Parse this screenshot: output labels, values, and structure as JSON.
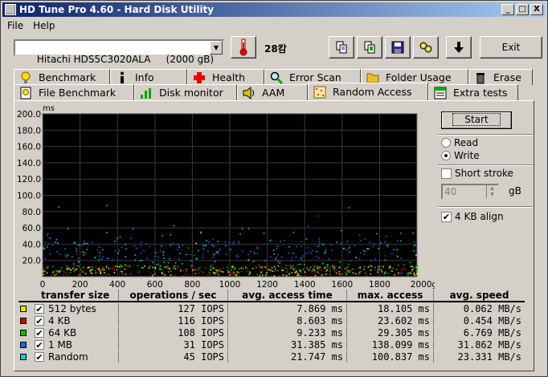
{
  "window": {
    "title": "HD Tune Pro 4.60 - Hard Disk Utility",
    "controls": [
      "_",
      "□",
      "X"
    ]
  },
  "menu": [
    "File",
    "Help"
  ],
  "toolbar": {
    "drive": "Hitachi HDS5C3020ALA     (2000 gB)",
    "temperature": "28캄",
    "exit_label": "Exit",
    "icons": [
      "thermometer-icon",
      "copy-icon",
      "copy-all-icon",
      "save-icon",
      "options-icon",
      "download-icon"
    ]
  },
  "tabs_top": [
    {
      "label": "Benchmark",
      "icon": "bulb-icon"
    },
    {
      "label": "Info",
      "icon": "info-icon"
    },
    {
      "label": "Health",
      "icon": "health-icon"
    },
    {
      "label": "Error Scan",
      "icon": "magnifier-icon"
    },
    {
      "label": "Folder Usage",
      "icon": "folder-icon"
    },
    {
      "label": "Erase",
      "icon": "trash-icon"
    }
  ],
  "tabs_bottom": [
    {
      "label": "File Benchmark",
      "icon": "bulb-file-icon"
    },
    {
      "label": "Disk monitor",
      "icon": "disk-monitor-icon"
    },
    {
      "label": "AAM",
      "icon": "speaker-icon"
    },
    {
      "label": "Random Access",
      "icon": "random-access-icon",
      "active": true
    },
    {
      "label": "Extra tests",
      "icon": "extra-tests-icon"
    }
  ],
  "side": {
    "start_label": "Start",
    "read_label": "Read",
    "write_label": "Write",
    "mode": "write",
    "short_stroke_label": "Short stroke",
    "short_stroke_checked": false,
    "short_stroke_value": "40",
    "unit": "gB",
    "align_label": "4 KB align",
    "align_checked": true
  },
  "chart_data": {
    "type": "scatter",
    "ylabel": "ms",
    "xlabel": "",
    "x_unit": "gB",
    "xlim": [
      0,
      2000
    ],
    "ylim": [
      0,
      200
    ],
    "xticks": [
      "0",
      "200",
      "400",
      "600",
      "800",
      "1000",
      "1200",
      "1400",
      "1600",
      "1800",
      "2000gB"
    ],
    "yticks": [
      "200.0",
      "180.0",
      "160.0",
      "140.0",
      "120.0",
      "100.0",
      "80.0",
      "60.0",
      "40.0",
      "20.0"
    ],
    "grid": true,
    "background": "#000000",
    "series": [
      {
        "name": "512 bytes",
        "color": "#e8e800",
        "y_typical": [
          2,
          14
        ]
      },
      {
        "name": "4 KB",
        "color": "#d00000",
        "y_typical": [
          2,
          14
        ]
      },
      {
        "name": "64 KB",
        "color": "#00c000",
        "y_typical": [
          3,
          16
        ]
      },
      {
        "name": "1 MB",
        "color": "#2060ff",
        "y_typical": [
          20,
          48
        ]
      },
      {
        "name": "Random",
        "color": "#00d0d0",
        "y_typical": [
          5,
          60
        ]
      }
    ]
  },
  "results": {
    "headers": [
      "transfer size",
      "operations / sec",
      "avg. access time",
      "max. access",
      "avg. speed"
    ],
    "rows": [
      {
        "color": "#e8e800",
        "size": "512 bytes",
        "ops": "127 IOPS",
        "avg": "7.869 ms",
        "max": "18.105 ms",
        "speed": "0.062 MB/s"
      },
      {
        "color": "#d00000",
        "size": "4 KB",
        "ops": "116 IOPS",
        "avg": "8.603 ms",
        "max": "23.602 ms",
        "speed": "0.454 MB/s"
      },
      {
        "color": "#00c000",
        "size": "64 KB",
        "ops": "108 IOPS",
        "avg": "9.233 ms",
        "max": "29.305 ms",
        "speed": "6.769 MB/s"
      },
      {
        "color": "#2060ff",
        "size": "1 MB",
        "ops": "31 IOPS",
        "avg": "31.385 ms",
        "max": "138.099 ms",
        "speed": "31.862 MB/s"
      },
      {
        "color": "#00d0d0",
        "size": "Random",
        "ops": "45 IOPS",
        "avg": "21.747 ms",
        "max": "100.837 ms",
        "speed": "23.331 MB/s"
      }
    ]
  }
}
